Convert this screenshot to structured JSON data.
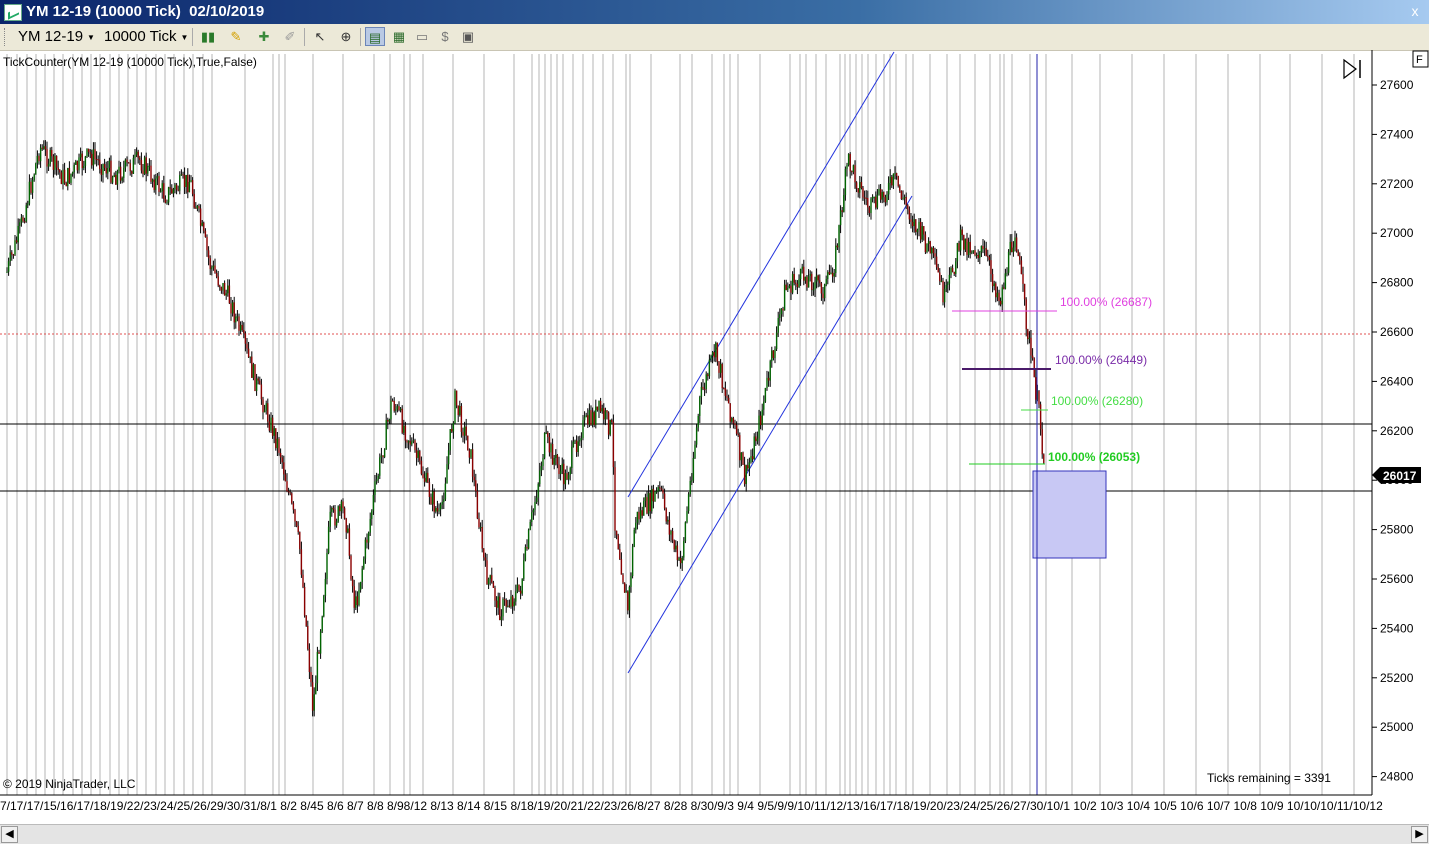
{
  "window": {
    "title": "YM 12-19 (10000 Tick)  02/10/2019",
    "close_label": "x"
  },
  "toolbar": {
    "instrument": "YM 12-19",
    "interval": "10000 Tick",
    "icons": [
      "bar-style-icon",
      "pencil-icon",
      "crosshair-icon",
      "eraser-icon",
      "pointer-icon",
      "zoom-icon",
      "chart-trader-icon",
      "data-box-icon",
      "properties-icon",
      "strategies-icon",
      "layout-icon"
    ]
  },
  "chart": {
    "indicator_label": "TickCounter(YM  12-19  (10000  Tick),True,False)",
    "copyright": "© 2019 NinjaTrader, LLC",
    "ticks_remaining": "Ticks remaining = 3391",
    "last_price": "26017",
    "corner_button": "F",
    "y_ticks": [
      "27600",
      "27400",
      "27200",
      "27000",
      "26800",
      "26600",
      "26400",
      "26200",
      "26000",
      "25800",
      "25600",
      "25400",
      "25200",
      "25000",
      "24800"
    ],
    "x_labels_text": "7/17/17/15/16/17/18/19/22/23/24/25/26/29/30/31/8/1  8/2  8/45  8/6  8/7  8/8 8/98/12  8/13 8/14  8/15 8/18/19/20/21/22/23/26/8/27  8/28 8/30/9/3  9/4 9/5/9/9/10/11/12/13/16/17/18/19/20/23/24/25/26/27/30/10/1  10/2  10/3  10/4  10/5  10/6  10/7  10/8  10/9 10/10/10/11/10/12",
    "fib_labels": [
      {
        "text": "100.00% (26687)",
        "color": "#e040e0"
      },
      {
        "text": "100.00% (26449)",
        "color": "#7a2ca8"
      },
      {
        "text": "100.00% (26280)",
        "color": "#44dd44"
      },
      {
        "text": "100.00% (26053)",
        "color": "#22cc22"
      }
    ],
    "colors": {
      "up_candle": "#006400",
      "down_candle": "#8b0000",
      "channel": "#2233dd",
      "cursor_line": "#2222aa",
      "box_fill": "#c8c8f4",
      "red_dotted": "#e05050"
    }
  },
  "scrollbar": {
    "left": "◀",
    "right": "▶"
  }
}
